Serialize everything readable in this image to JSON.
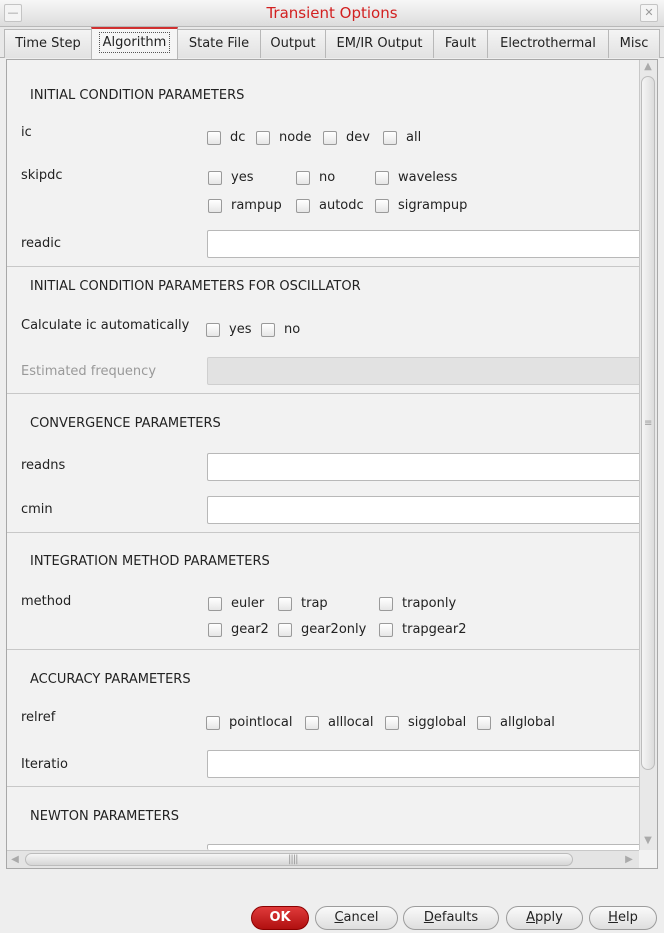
{
  "window": {
    "title": "Transient Options"
  },
  "tabs": [
    {
      "label": "Time Step"
    },
    {
      "label": "Algorithm"
    },
    {
      "label": "State File"
    },
    {
      "label": "Output"
    },
    {
      "label": "EM/IR Output"
    },
    {
      "label": "Fault"
    },
    {
      "label": "Electrothermal"
    },
    {
      "label": "Misc"
    }
  ],
  "active_tab": "Algorithm",
  "sections": {
    "initial": "INITIAL CONDITION PARAMETERS",
    "osc": "INITIAL CONDITION PARAMETERS FOR OSCILLATOR",
    "convergence": "CONVERGENCE PARAMETERS",
    "integration": "INTEGRATION METHOD PARAMETERS",
    "accuracy": "ACCURACY PARAMETERS",
    "newton": "NEWTON PARAMETERS"
  },
  "fields": {
    "ic": {
      "label": "ic",
      "options": [
        "dc",
        "node",
        "dev",
        "all"
      ]
    },
    "skipdc": {
      "label": "skipdc",
      "options": [
        "yes",
        "no",
        "waveless",
        "rampup",
        "autodc",
        "sigrampup"
      ]
    },
    "readic": {
      "label": "readic",
      "value": ""
    },
    "calc_ic": {
      "label": "Calculate ic automatically",
      "options": [
        "yes",
        "no"
      ]
    },
    "est_freq": {
      "label": "Estimated frequency",
      "value": ""
    },
    "readns": {
      "label": "readns",
      "value": ""
    },
    "cmin": {
      "label": "cmin",
      "value": ""
    },
    "method": {
      "label": "method",
      "options": [
        "euler",
        "trap",
        "traponly",
        "gear2",
        "gear2only",
        "trapgear2"
      ]
    },
    "relref": {
      "label": "relref",
      "options": [
        "pointlocal",
        "alllocal",
        "sigglobal",
        "allglobal"
      ]
    },
    "iteratio": {
      "label": "Iteratio",
      "value": ""
    }
  },
  "buttons": {
    "ok": "OK",
    "cancel": {
      "first": "C",
      "rest": "ancel"
    },
    "defaults": {
      "first": "D",
      "rest": "efaults"
    },
    "apply": {
      "first": "A",
      "rest": "pply"
    },
    "help": {
      "first": "H",
      "rest": "elp"
    }
  },
  "icons": {
    "window_menu": "minus-icon",
    "window_close": "close-icon",
    "scroll_up": "triangle-up-icon",
    "scroll_down": "triangle-down-icon",
    "scroll_left": "triangle-left-icon",
    "scroll_right": "triangle-right-icon"
  },
  "colors": {
    "title": "#d22020",
    "active_tab_accent": "#d03030",
    "ok_button": "#c01818"
  }
}
